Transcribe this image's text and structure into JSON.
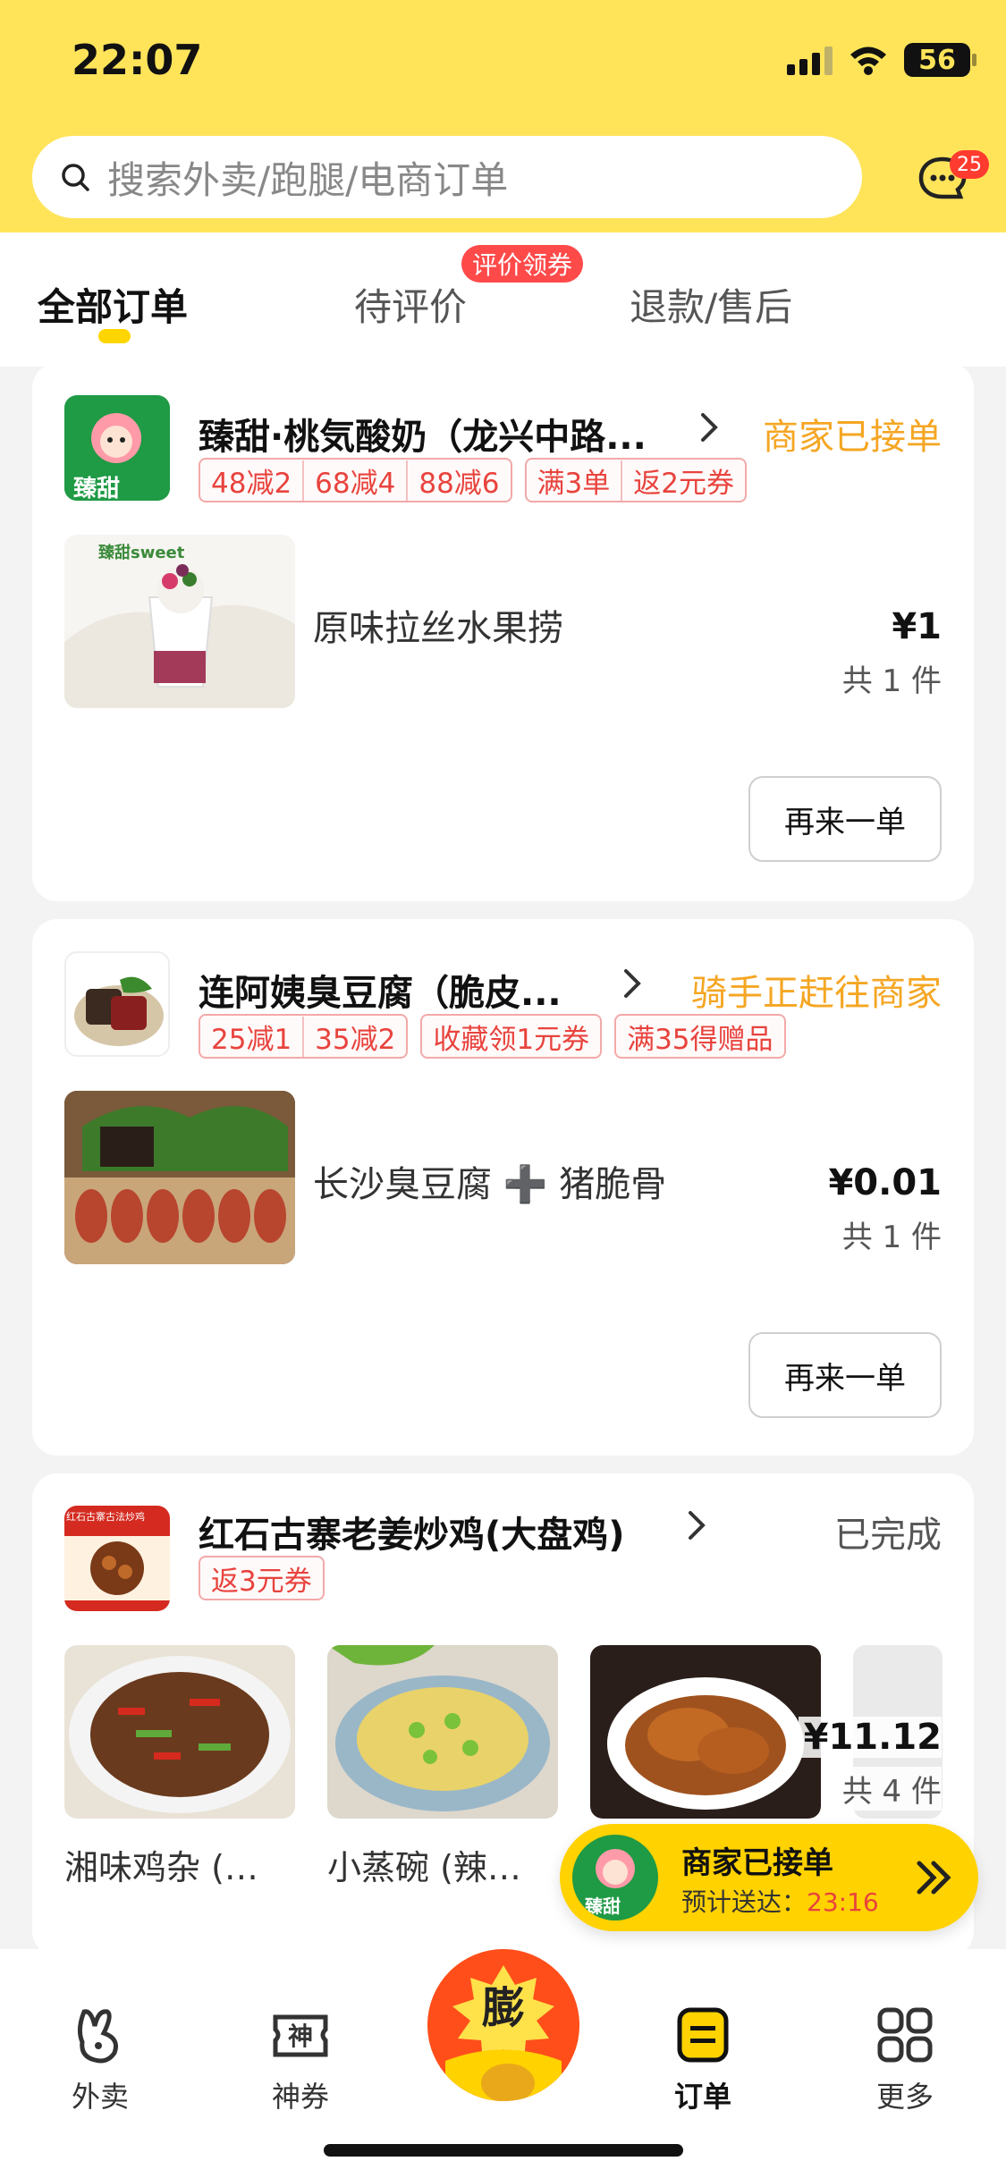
{
  "status_bar": {
    "time": "22:07",
    "battery": "56"
  },
  "search": {
    "placeholder": "搜索外卖/跑腿/电商订单"
  },
  "messages": {
    "badge": "25"
  },
  "tabs": [
    {
      "label": "全部订单",
      "active": true
    },
    {
      "label": "待评价",
      "badge": "评价领券"
    },
    {
      "label": "退款/售后"
    }
  ],
  "orders": [
    {
      "shop": "臻甜·桃気酸奶（龙兴中路...",
      "status": "商家已接单",
      "status_color": "#f5a623",
      "tags": [
        [
          "48减2",
          "68减4",
          "88减6"
        ],
        [
          "满3单",
          "返2元券"
        ]
      ],
      "item_name": "原味拉丝水果捞",
      "price": "¥1",
      "count": "共 1 件",
      "reorder": "再来一单",
      "logo_text": "臻甜",
      "img_brand": "臻甜sweet"
    },
    {
      "shop": "连阿姨臭豆腐（脆皮...",
      "status": "骑手正赶往商家",
      "status_color": "#f5a623",
      "tags": [
        [
          "25减1",
          "35减2"
        ],
        [
          "收藏领1元券"
        ],
        [
          "满35得赠品"
        ]
      ],
      "item_name": "长沙臭豆腐 ➕ 猪脆骨",
      "price": "¥0.01",
      "count": "共 1 件",
      "reorder": "再来一单"
    },
    {
      "shop": "红石古寨老姜炒鸡(大盘鸡)",
      "status": "已完成",
      "status_color": "#555555",
      "tags": [
        [
          "返3元券"
        ]
      ],
      "thumbs": [
        "湘味鸡杂 (…",
        "小蒸碗 (辣…"
      ],
      "price": "¥11.12",
      "count": "共 4 件",
      "logo_text": "红石古寨古法炒鸡"
    }
  ],
  "floating": {
    "title": "商家已接单",
    "eta_label": "预计送达：",
    "eta_time": "23:16",
    "logo_text": "臻甜"
  },
  "nav": [
    {
      "label": "外卖",
      "icon": "takeout-icon"
    },
    {
      "label": "神券",
      "icon": "coupon-icon",
      "glyph": "神"
    },
    {
      "label": "膨",
      "icon": "center-promo-icon"
    },
    {
      "label": "订单",
      "icon": "orders-icon",
      "active": true
    },
    {
      "label": "更多",
      "icon": "more-icon"
    }
  ]
}
